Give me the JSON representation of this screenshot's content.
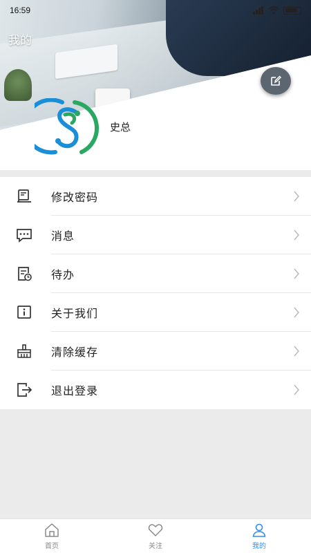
{
  "status_bar": {
    "time": "16:59",
    "battery": ""
  },
  "header": {
    "title": "我的"
  },
  "profile": {
    "name": "史总"
  },
  "colors": {
    "accent": "#2c8ef5",
    "logo_blue": "#1a8fd8",
    "logo_green": "#28a860",
    "inactive": "#8a8a8a"
  },
  "menu": {
    "items": [
      {
        "label": "修改密码",
        "icon": "document-lock-icon"
      },
      {
        "label": "消息",
        "icon": "chat-bubble-icon"
      },
      {
        "label": "待办",
        "icon": "todo-clock-icon"
      },
      {
        "label": "关于我们",
        "icon": "info-icon"
      },
      {
        "label": "清除缓存",
        "icon": "broom-icon"
      },
      {
        "label": "退出登录",
        "icon": "logout-icon"
      }
    ]
  },
  "tabbar": {
    "tabs": [
      {
        "label": "首页",
        "icon": "home-icon",
        "active": false
      },
      {
        "label": "关注",
        "icon": "heart-icon",
        "active": false
      },
      {
        "label": "我的",
        "icon": "user-icon",
        "active": true
      }
    ]
  }
}
